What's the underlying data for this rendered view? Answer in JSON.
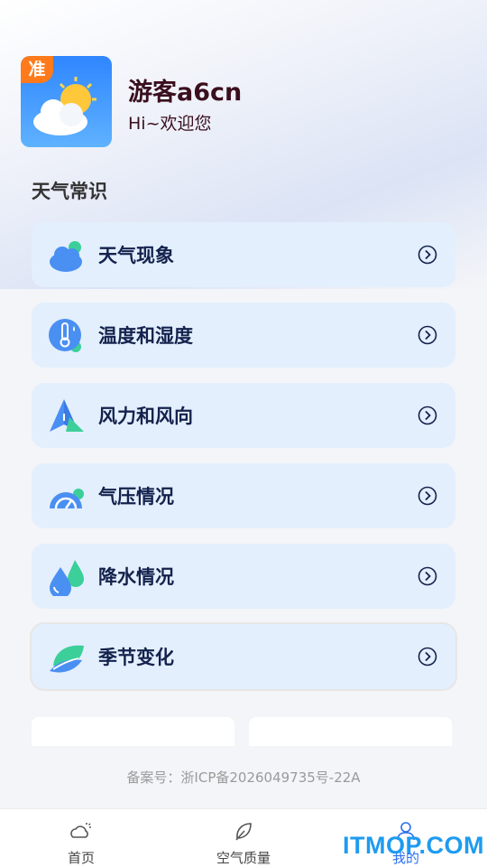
{
  "profile": {
    "badge": "准",
    "username": "游客a6cn",
    "greeting": "Hi~欢迎您"
  },
  "section": {
    "title": "天气常识"
  },
  "cards": [
    {
      "label": "天气现象",
      "icon": "cloud-icon"
    },
    {
      "label": "温度和湿度",
      "icon": "thermometer-icon"
    },
    {
      "label": "风力和风向",
      "icon": "wind-direction-icon"
    },
    {
      "label": "气压情况",
      "icon": "pressure-gauge-icon"
    },
    {
      "label": "降水情况",
      "icon": "raindrop-icon"
    },
    {
      "label": "季节变化",
      "icon": "leaf-icon"
    }
  ],
  "footer": {
    "icp": "备案号：浙ICP备2026049735号-22A"
  },
  "tabs": [
    {
      "label": "首页",
      "icon": "weather-icon"
    },
    {
      "label": "空气质量",
      "icon": "leaf-outline-icon"
    },
    {
      "label": "我的",
      "icon": "user-icon"
    }
  ],
  "watermark": "ITMOP.COM",
  "colors": {
    "card_bg": "#e3effd",
    "accent": "#2a6ef0",
    "badge": "#ff7a1a"
  }
}
